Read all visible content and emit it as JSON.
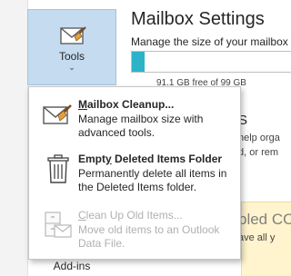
{
  "ribbon": {
    "tools_label": "Tools",
    "tools_chevron": "⌄",
    "addins_label": "Add-ins"
  },
  "mailbox": {
    "heading": "Mailbox Settings",
    "subheading": "Manage the size of your mailbox",
    "quota_text": "91.1 GB free of 99 GB",
    "quota_used_fraction": 0.08,
    "quota_color": "#2cb3c8"
  },
  "background_fragments": {
    "frag1": "S",
    "frag2": "help orga",
    "frag3": "d, or rem",
    "frag4": "bled CO",
    "frag5": "ave all y"
  },
  "menu": {
    "items": [
      {
        "title_underline": "M",
        "title_rest": "ailbox Cleanup...",
        "description": "Manage mailbox size with advanced tools.",
        "icon": "mailbox-cleanup-icon",
        "enabled": true
      },
      {
        "title_pre": "Empt",
        "title_underline": "y",
        "title_rest": " Deleted Items Folder",
        "description": "Permanently delete all items in the Deleted Items folder.",
        "icon": "trash-can-icon",
        "enabled": true
      },
      {
        "title_underline": "C",
        "title_rest": "lean Up Old Items...",
        "description": "Move old items to an Outlook Data File.",
        "icon": "archive-cabinet-icon",
        "enabled": false
      }
    ]
  }
}
